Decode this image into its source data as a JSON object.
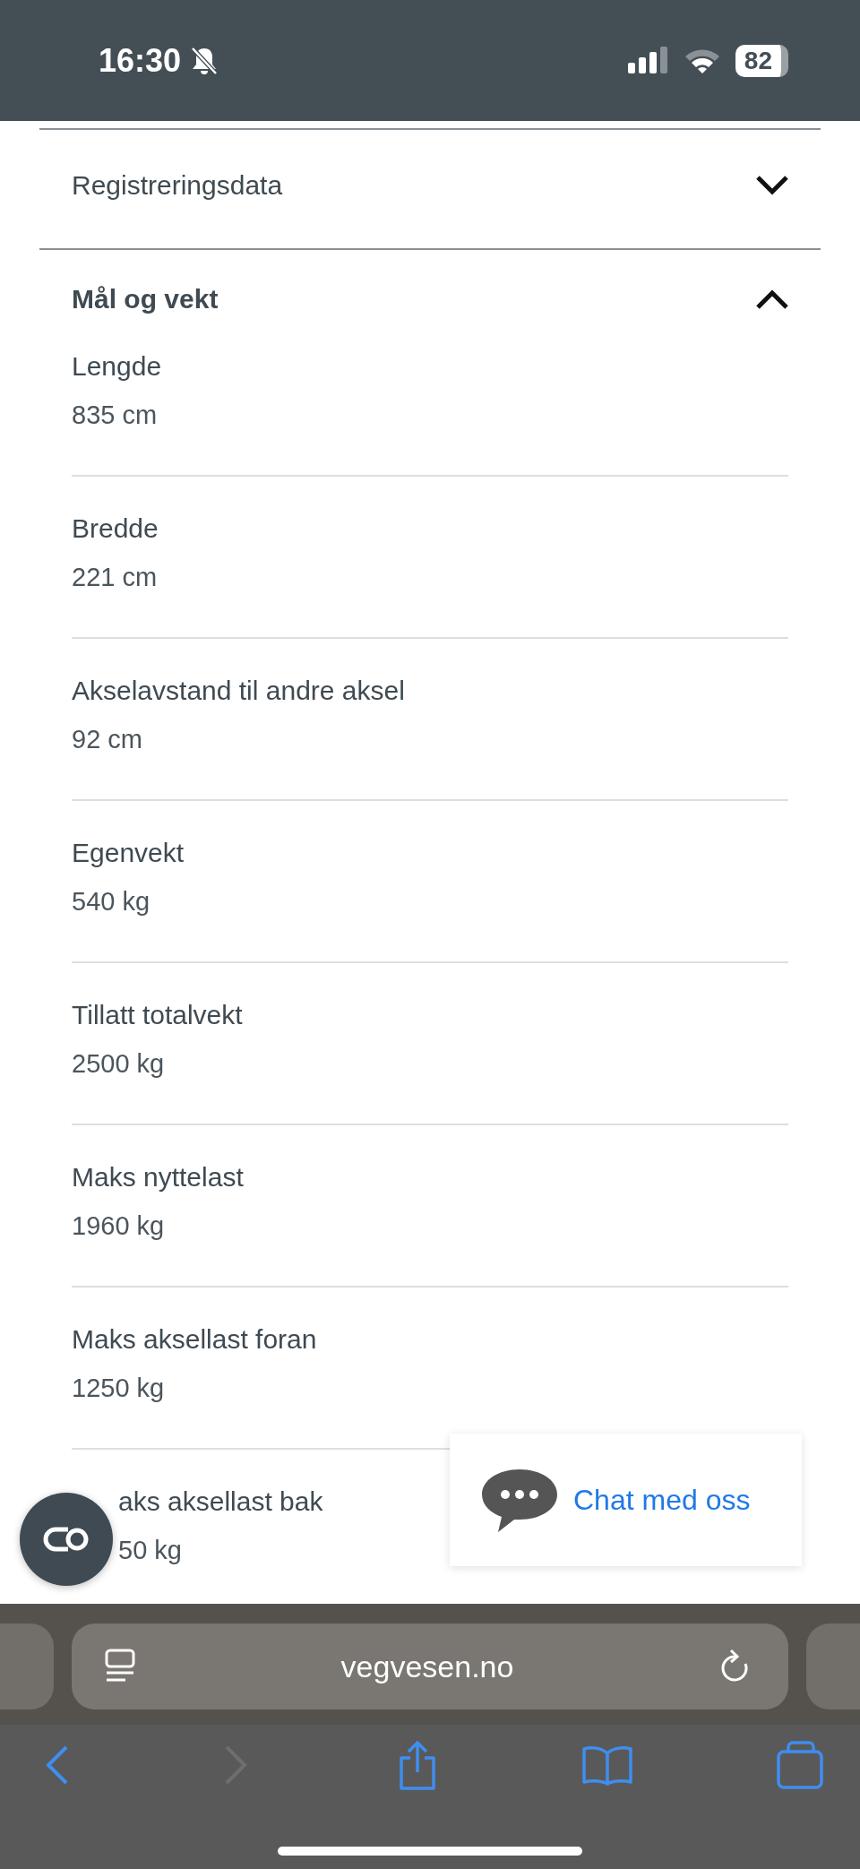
{
  "status_bar": {
    "time": "16:30",
    "battery": "82"
  },
  "sections": [
    {
      "title": "Registreringsdata",
      "expanded": false
    },
    {
      "title": "Mål og vekt",
      "expanded": true,
      "items": [
        {
          "label": "Lengde",
          "value": "835 cm",
          "covered": false
        },
        {
          "label": "Bredde",
          "value": "221 cm",
          "covered": false
        },
        {
          "label": "Akselavstand til andre aksel",
          "value": "92 cm",
          "covered": false
        },
        {
          "label": "Egenvekt",
          "value": "540 kg",
          "covered": false
        },
        {
          "label": "Tillatt totalvekt",
          "value": "2500 kg",
          "covered": false
        },
        {
          "label": "Maks nyttelast",
          "value": "1960 kg",
          "covered": false
        },
        {
          "label": "Maks aksellast foran",
          "value": "1250 kg",
          "covered": false
        },
        {
          "label": "aks aksellast bak",
          "value": "50 kg",
          "covered": true
        }
      ]
    }
  ],
  "chat": {
    "label": "Chat med oss"
  },
  "browser": {
    "url": "vegvesen.no",
    "back_disabled": false,
    "forward_disabled": true
  }
}
